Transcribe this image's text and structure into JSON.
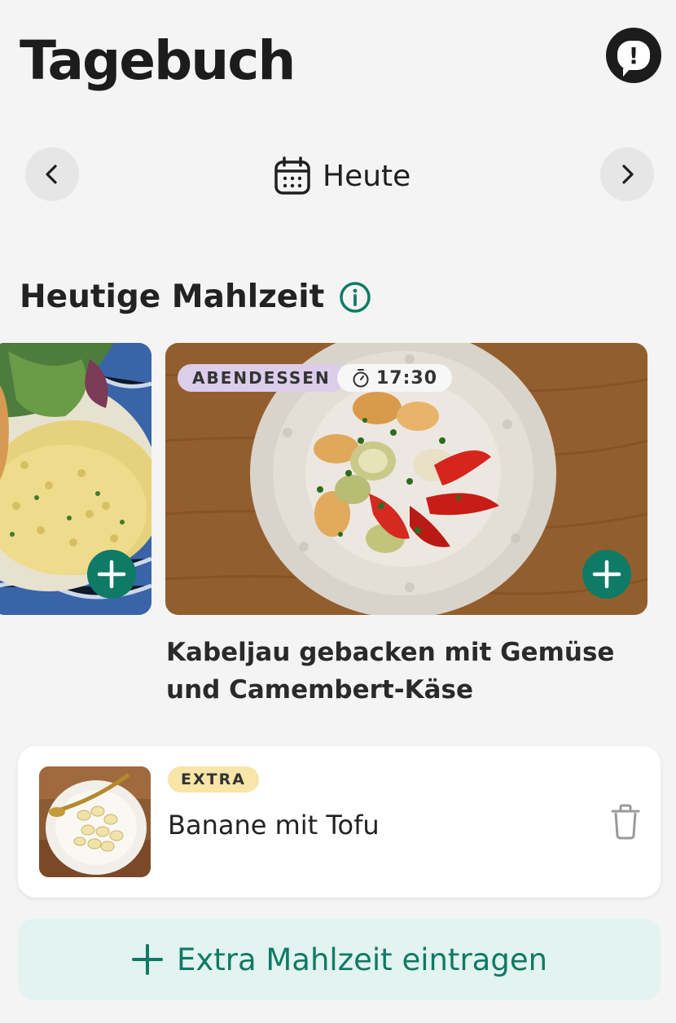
{
  "header": {
    "title": "Tagebuch",
    "feedback_icon": "feedback-exclamation-icon"
  },
  "date_nav": {
    "prev_icon": "chevron-left-icon",
    "next_icon": "chevron-right-icon",
    "calendar_icon": "calendar-icon",
    "label": "Heute"
  },
  "section": {
    "title": "Heutige Mahlzeit",
    "info_icon": "info-icon"
  },
  "meals": [
    {
      "type_badge": "ABENDESSEN",
      "time": "17:30",
      "name": "Kabeljau gebacken mit Gemüse und Camembert-Käse"
    }
  ],
  "extras": [
    {
      "badge": "EXTRA",
      "name": "Banane mit Tofu"
    }
  ],
  "add_extra": {
    "label": "Extra Mahlzeit eintragen"
  },
  "colors": {
    "accent": "#0f7a66",
    "meal_badge": "#dccdea",
    "extra_badge": "#f8e5a8",
    "add_extra_bg": "#e2f3f0",
    "background": "#f4f4f4"
  }
}
